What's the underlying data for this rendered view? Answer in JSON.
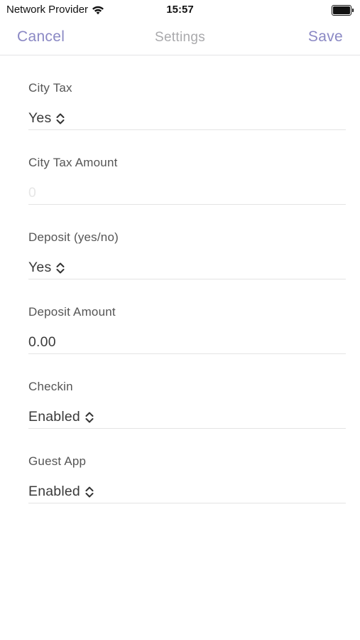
{
  "status_bar": {
    "carrier": "Network Provider",
    "time": "15:57"
  },
  "nav": {
    "cancel_label": "Cancel",
    "title": "Settings",
    "save_label": "Save"
  },
  "fields": {
    "city_tax": {
      "label": "City Tax",
      "value": "Yes"
    },
    "city_tax_amount": {
      "label": "City Tax Amount",
      "value": "",
      "placeholder": "0"
    },
    "deposit": {
      "label": "Deposit (yes/no)",
      "value": "Yes"
    },
    "deposit_amount": {
      "label": "Deposit Amount",
      "value": "0.00"
    },
    "checkin": {
      "label": "Checkin",
      "value": "Enabled"
    },
    "guest_app": {
      "label": "Guest App",
      "value": "Enabled"
    }
  },
  "colors": {
    "accent": "#8a88c4",
    "title": "#a9a9ac",
    "separator": "#e4e4e4"
  },
  "icons": {
    "wifi": "wifi-icon",
    "battery": "battery-icon",
    "picker": "up-down-chevron-icon"
  }
}
